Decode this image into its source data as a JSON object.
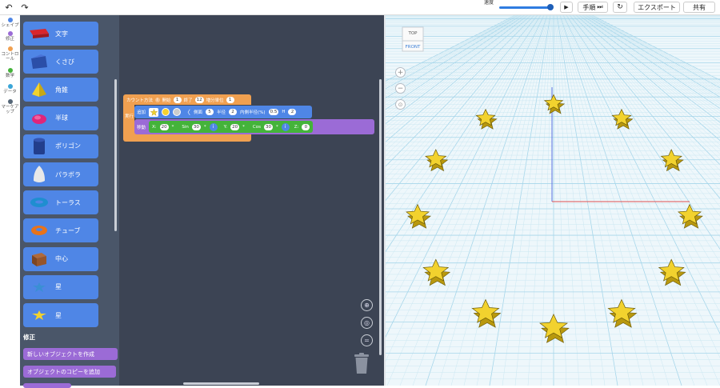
{
  "toolbar": {
    "undo_icon": "undo-icon",
    "redo_icon": "redo-icon",
    "speed_label": "速度",
    "step_label": "手順",
    "export_label": "エクスポート",
    "share_label": "共有"
  },
  "rail": {
    "categories": [
      {
        "label": "シェイプ",
        "color": "#4f86e6"
      },
      {
        "label": "修正",
        "color": "#9b6bd6"
      },
      {
        "label": "コントロール",
        "color": "#f0a050"
      },
      {
        "label": "数学",
        "color": "#44b33a"
      },
      {
        "label": "データ",
        "color": "#3ba6d8"
      },
      {
        "label": "マーケアップ",
        "color": "#556677"
      }
    ]
  },
  "palette": {
    "shapes": [
      {
        "label": "文字",
        "icon": "text-shape-icon"
      },
      {
        "label": "くさび",
        "icon": "wedge-icon"
      },
      {
        "label": "角錐",
        "icon": "pyramid-icon"
      },
      {
        "label": "半球",
        "icon": "half-sphere-icon"
      },
      {
        "label": "ポリゴン",
        "icon": "polygon-icon"
      },
      {
        "label": "パラボラ",
        "icon": "paraboloid-icon"
      },
      {
        "label": "トーラス",
        "icon": "torus-icon"
      },
      {
        "label": "チューブ",
        "icon": "tube-icon"
      },
      {
        "label": "中心",
        "icon": "box-icon"
      },
      {
        "label": "星",
        "icon": "star-icon"
      },
      {
        "label": "星",
        "icon": "star-yellow-icon"
      }
    ],
    "section_modify": "修正",
    "modify_blocks": [
      "新しいオブジェクトを作成",
      "オブジェクトのコピーを追加"
    ]
  },
  "blocks": {
    "loop": {
      "label": "カウント方法",
      "var": "i",
      "start_label": "開始",
      "start": "1",
      "end_label": "終了",
      "end": "12",
      "step_label": "増分単位",
      "step": "1",
      "do_label": "実行"
    },
    "add": {
      "label": "追加",
      "color": "#f5d130",
      "sides_label": "側面",
      "sides": "5",
      "radius_label": "半径",
      "radius": "2",
      "inner_label": "内側半径(%)",
      "inner": "0.5",
      "height_label": "H",
      "height": "2"
    },
    "move": {
      "label": "移動",
      "x_label": "X:",
      "x1": "20",
      "op1": "*",
      "fn1": "Sin",
      "x2": "30",
      "op2": "*",
      "var1": "i",
      "y_label": "Y:",
      "y1": "20",
      "op3": "*",
      "fn2": "Cos",
      "y2": "30",
      "op4": "*",
      "var2": "i",
      "z_label": "Z:",
      "z": "0"
    }
  },
  "viewport": {
    "cube_top": "TOP",
    "cube_front": "FRONT",
    "zoom_in_icon": "plus-icon",
    "zoom_out_icon": "minus-icon",
    "fit_icon": "fit-view-icon",
    "star_color": "#f2d22e",
    "star_count": 12
  }
}
